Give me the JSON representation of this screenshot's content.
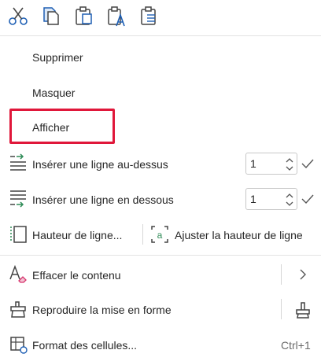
{
  "toolbar": {
    "icons": [
      "scissors-icon",
      "copy-icon",
      "paste-icon",
      "paste-text-icon",
      "paste-list-icon"
    ]
  },
  "menu": {
    "delete_label": "Supprimer",
    "hide_label": "Masquer",
    "show_label": "Afficher",
    "insert_above_label": "Insérer une ligne au-dessus",
    "insert_above_value": "1",
    "insert_below_label": "Insérer une ligne en dessous",
    "insert_below_value": "1",
    "row_height_label": "Hauteur de ligne...",
    "autofit_label": "Ajuster la hauteur de ligne",
    "clear_contents_label": "Effacer le contenu",
    "format_painter_label": "Reproduire la mise en forme",
    "format_cells_label": "Format des cellules...",
    "format_cells_shortcut": "Ctrl+1"
  },
  "colors": {
    "accent_blue": "#1e5fb4",
    "icon_gray": "#444444",
    "highlight_red": "#e0173a",
    "eraser_pink": "#d6336c",
    "insert_green": "#2e8b57"
  }
}
